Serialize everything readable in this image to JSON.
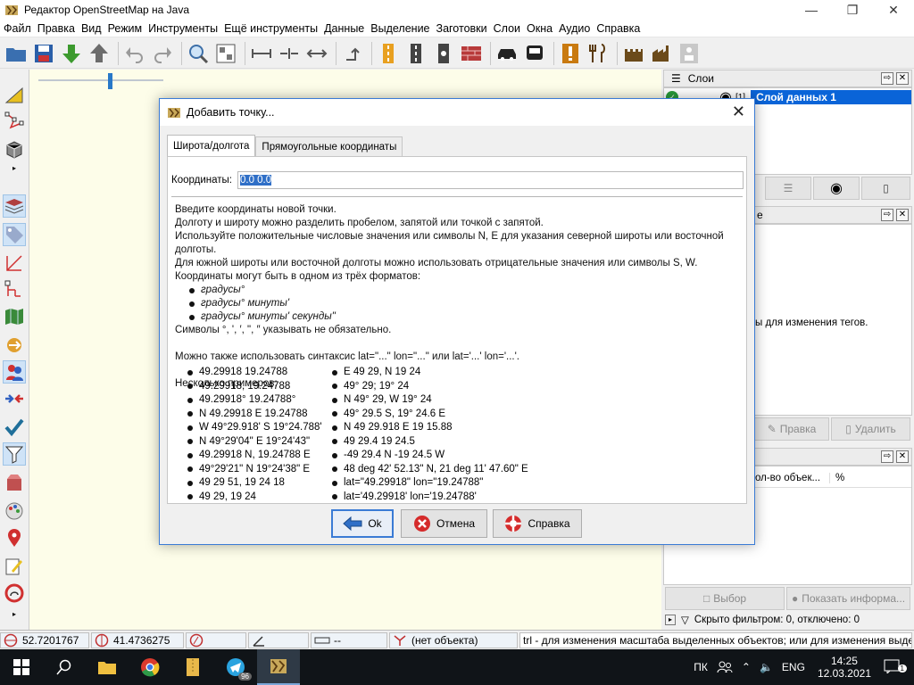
{
  "window": {
    "title": "Редактор OpenStreetMap на Java"
  },
  "menu": [
    "Файл",
    "Правка",
    "Вид",
    "Режим",
    "Инструменты",
    "Ещё инструменты",
    "Данные",
    "Выделение",
    "Заготовки",
    "Слои",
    "Окна",
    "Аудио",
    "Справка"
  ],
  "layers_panel": {
    "title": "Слои",
    "layer_index": "[1]",
    "layer_name": "Слой данных 1"
  },
  "tags_panel": {
    "title_tail": "e",
    "hint_tail": "ы для изменения тегов.",
    "edit_button": "Правка",
    "delete_button": "Удалить"
  },
  "selection_panel": {
    "col1": "ол-во объек...",
    "col2": "%",
    "select_button": "Выбор",
    "info_button": "Показать информа...",
    "filter_text": "Скрыто фильтром: 0, отключено: 0"
  },
  "dialog": {
    "title": "Добавить точку...",
    "tab_latlon": "Широта/долгота",
    "tab_rect": "Прямоугольные координаты",
    "coord_label": "Координаты:",
    "coord_value": "0.0 0.0",
    "help_lines": [
      "Введите координаты новой точки.",
      "Долготу и широту можно разделить пробелом, запятой или точкой с запятой.",
      "Используйте положительные числовые значения или символы N, E для указания северной широты или восточной долготы.",
      "Для южной широты или восточной долготы можно использовать отрицательные значения или символы S, W.",
      "Координаты могут быть в одном из трёх форматов:"
    ],
    "formats": [
      "градусы°",
      "градусы° минуты'",
      "градусы° минуты' секунды\""
    ],
    "optional_symbols": "Символы °, ', ′, \", ″ указывать не обязательно.",
    "syntax_note": "Можно также использовать синтаксис lat=\"...\" lon=\"...\" или lat='...' lon='...'.",
    "examples_title": "Несколько примеров:",
    "examples_left": [
      "49.29918 19.24788",
      "49.29918, 19.24788",
      "49.29918° 19.24788°",
      "N 49.29918 E 19.24788",
      "W 49°29.918' S 19°24.788'",
      "N 49°29'04\" E 19°24'43\"",
      "49.29918 N, 19.24788 E",
      "49°29'21\" N 19°24'38\" E",
      "49 29 51, 19 24 18",
      "49 29, 19 24"
    ],
    "examples_right": [
      "E 49 29, N 19 24",
      "49° 29; 19° 24",
      "N 49° 29, W 19° 24",
      "49° 29.5 S, 19° 24.6 E",
      "N 49 29.918 E 19 15.88",
      "49 29.4 19 24.5",
      "-49 29.4 N -19 24.5 W",
      "48 deg 42' 52.13\" N, 21 deg 11' 47.60\" E",
      "lat=\"49.29918\" lon=\"19.24788\"",
      "lat='49.29918' lon='19.24788'"
    ],
    "ok": "Ok",
    "cancel": "Отмена",
    "help": "Справка"
  },
  "status": {
    "lat": "52.7201767",
    "lon": "41.4736275",
    "angle": "--",
    "length": "--",
    "object": "(нет объекта)",
    "hint": "trl - для изменения масштаба выделенных объектов; или для изменения выделения"
  },
  "taskbar": {
    "lang_short": "ПК",
    "lang": "ENG",
    "time": "14:25",
    "date": "12.03.2021",
    "badge": "96",
    "notif": "1"
  },
  "colors": {
    "accent": "#2f6fc7",
    "map_bg": "#fdfde9",
    "selected_layer": "#0a64d8"
  }
}
